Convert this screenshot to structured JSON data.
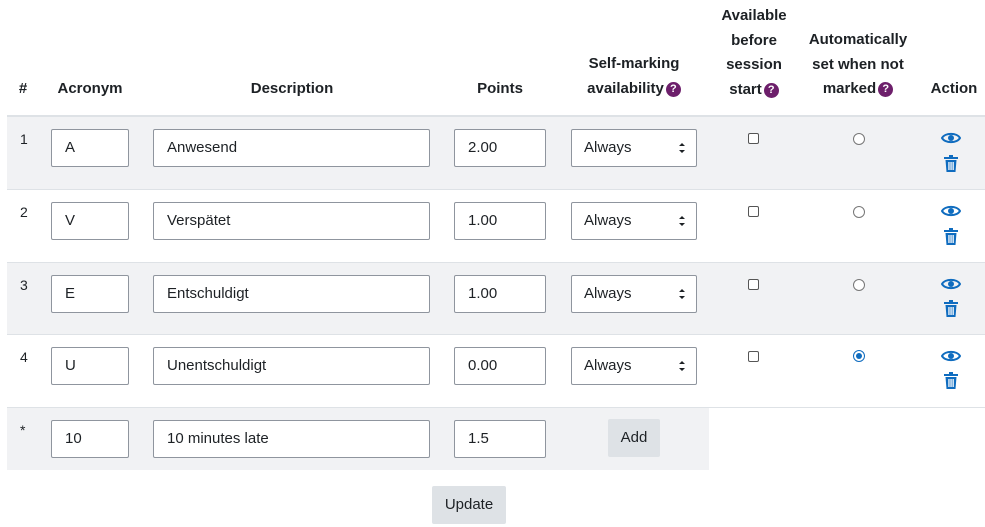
{
  "header": {
    "num": "#",
    "acronym": "Acronym",
    "description": "Description",
    "points": "Points",
    "self_marking_l1": "Self-marking",
    "self_marking_l2": "availability",
    "available_l1": "Available",
    "available_l2": "before",
    "available_l3": "session",
    "available_l4": "start",
    "auto_l1": "Automatically",
    "auto_l2": "set when not",
    "auto_l3": "marked",
    "action": "Action",
    "help_glyph": "?"
  },
  "rows": [
    {
      "num": "1",
      "acronym": "A",
      "description": "Anwesend",
      "points": "2.00",
      "availability": "Always",
      "available_before_start": false,
      "auto_set": false
    },
    {
      "num": "2",
      "acronym": "V",
      "description": "Verspätet",
      "points": "1.00",
      "availability": "Always",
      "available_before_start": false,
      "auto_set": false
    },
    {
      "num": "3",
      "acronym": "E",
      "description": "Entschuldigt",
      "points": "1.00",
      "availability": "Always",
      "available_before_start": false,
      "auto_set": false
    },
    {
      "num": "4",
      "acronym": "U",
      "description": "Unentschuldigt",
      "points": "0.00",
      "availability": "Always",
      "available_before_start": false,
      "auto_set": true
    }
  ],
  "new_row": {
    "num": "*",
    "acronym": "10",
    "description": "10 minutes late",
    "points": "1.5",
    "add_label": "Add"
  },
  "update_label": "Update",
  "icons": {
    "show": "eye-icon",
    "delete": "trash-icon"
  },
  "colors": {
    "accent": "#0f6cbf",
    "help": "#6d1f6b",
    "row_alt": "#f1f2f4",
    "button": "#dee2e6"
  }
}
